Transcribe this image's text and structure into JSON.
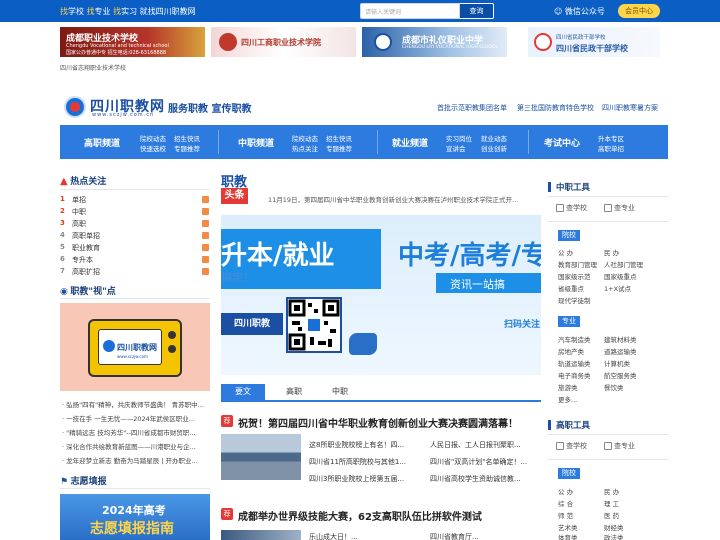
{
  "topbar": {
    "slogan_parts": [
      {
        "hl": "找",
        "txt": "学校 "
      },
      {
        "hl": "找",
        "txt": "专业 "
      },
      {
        "hl": "找",
        "txt": "实习 就找四川职教网"
      }
    ],
    "search_placeholder": "请输入关键词",
    "search_button": "查询",
    "wechat": "微信公众号",
    "member_button": "会员中心"
  },
  "ads": {
    "ad1_title": "成都职业技术学校",
    "ad1_sub": "Chengdu Vocational and technical school",
    "ad1_sub2": "国家公办普通中专  招生电话:028-63168888",
    "ad2_title": "四川工商职业技术学院",
    "ad3_title": "成都市礼仪职业中学",
    "ad3_sub": "CHENGDU LIYI VOCATIONAL HIGH SCHOOL",
    "ad4_title": "四川省民政干部学校",
    "ad4_title2": "四川省民政干部学校",
    "caption": "四川省志翔职业技术学校"
  },
  "header": {
    "site_name": "四川职教网",
    "site_url": "www.sczjw.com.cn",
    "tagline": "服务职教 宣传职教",
    "links": [
      "首批示范职教集团名单",
      "第三批国防教育特色学校",
      "四川职教寒暑方案"
    ]
  },
  "nav": {
    "blocks": [
      {
        "title": "高职频道",
        "subs": [
          "院校动态",
          "招生快讯",
          "快速选校",
          "专题推荐"
        ]
      },
      {
        "title": "中职频道",
        "subs": [
          "院校动态",
          "招生快讯",
          "热点关注",
          "专题推荐"
        ]
      },
      {
        "title": "就业频道",
        "subs": [
          "实习岗位",
          "就业动态",
          "宣讲会",
          "创业创新"
        ]
      },
      {
        "title": "考试中心",
        "subs": [
          "升本专区",
          "高职单招"
        ]
      }
    ]
  },
  "hot": {
    "title": "热点关注",
    "items": [
      {
        "num": "1",
        "label": "单招"
      },
      {
        "num": "2",
        "label": "中职"
      },
      {
        "num": "3",
        "label": "高职"
      },
      {
        "num": "4",
        "label": "高职单招"
      },
      {
        "num": "5",
        "label": "职业教育"
      },
      {
        "num": "6",
        "label": "专升本"
      },
      {
        "num": "7",
        "label": "高职扩招"
      }
    ]
  },
  "video": {
    "title": "职教\"视\"点",
    "tv_text": "四川职教网",
    "tv_url": "www.sczjw.com",
    "items": [
      "弘扬\"四有\"精神，共庆教师节盛典！ 青苏职中...",
      "一技在手 一生无忧——2024年武侯区职业...",
      "\"精骑远志 技均芳华\"--四川省成都市财贸职...",
      "深化合作共绘教育新蓝图——川港职业与企...",
      "龙年迎梦立新志 勤奋为马踏星辰 | 开办职业..."
    ]
  },
  "zhiyuan": {
    "title": "志愿填报",
    "banner_1": "2024年高考",
    "banner_2": "志愿填报指南"
  },
  "headline": {
    "badge1": "职教",
    "badge2": "头条",
    "text": "11月19日，第四届四川省中华职业教育创新创业大赛决赛在泸州职业技术学院正式开..."
  },
  "banner": {
    "left_big": "升本/就业",
    "left_small": "搞定！",
    "right_title": "中考/高考/专升",
    "right_sub": "资讯一站搞",
    "brand": "四川职教",
    "scan": "扫码关注"
  },
  "tabs": [
    "要文",
    "高职",
    "中职"
  ],
  "features": [
    {
      "badge": "荐",
      "title": "祝贺！第四届四川省中华职业教育创新创业大赛决赛圆满落幕！",
      "news": [
        [
          "这8所职业院校榜上有名！四...",
          "人民日报、工人日报刊聚职..."
        ],
        [
          "四川省11所高职院校与其他1...",
          "四川省\"双高计划\"名单确定！..."
        ],
        [
          "四川3所职业院校上榜第五届...",
          "四川省高校学生资助诚信教..."
        ]
      ]
    },
    {
      "badge": "荐",
      "title": "成都举办世界级技能大赛，62支高职队伍比拼软件测试",
      "news": [
        [
          "乐山成大日！...",
          "四川省教育厅..."
        ]
      ]
    }
  ],
  "right": {
    "zhongzhi": {
      "title": "中职工具",
      "quick": [
        "查学校",
        "查专业"
      ],
      "yuanxiao_tag": "院校",
      "yuanxiao": [
        "公 办",
        "民 办",
        "教育部门管理",
        "人社部门管理",
        "国家级示范",
        "国家级重点",
        "省级重点",
        "1+X试点",
        "现代学徒制"
      ],
      "zhuanye_tag": "专业",
      "zhuanye": [
        "汽车制造类",
        "建筑材料类",
        "房地产类",
        "道路运输类",
        "轨道运输类",
        "计算机类",
        "电子商务类",
        "航空服务类",
        "旅游类",
        "餐饮类",
        "更多..."
      ]
    },
    "gaozhi": {
      "title": "高职工具",
      "quick": [
        "查学校",
        "查专业"
      ],
      "yuanxiao_tag": "院校",
      "yuanxiao": [
        "公 办",
        "民 办",
        "综 合",
        "理 工",
        "师 范",
        "医 药",
        "艺术类",
        "财经类",
        "体育类",
        "政法类"
      ]
    }
  },
  "colors": {
    "brand_blue": "#0b5fc4",
    "nav_blue": "#2e7be0",
    "accent_red": "#e53935",
    "accent_yellow": "#ffd54a"
  }
}
